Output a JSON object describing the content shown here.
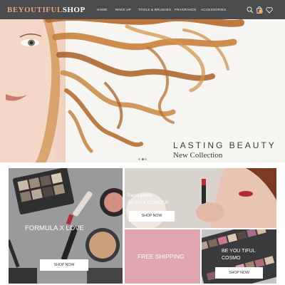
{
  "header": {
    "logo_part1": "BEYOUTIFUL",
    "logo_part2": "SHOP",
    "nav": [
      "HOME",
      "MAKE UP",
      "TOOLS & BRUSHES",
      "FRAGRANCE",
      "ACCESSORIES"
    ],
    "icons": [
      "search-icon",
      "bag-icon",
      "heart-icon"
    ],
    "cart_count": "0"
  },
  "hero": {
    "title": "LASTING BEAUTY",
    "subtitle": "New Collection",
    "slide_count": 3,
    "active_slide": 2
  },
  "tiles": {
    "formula": {
      "label": "FORMULA X LOVE",
      "button": "SHOP NOW"
    },
    "lipstick": {
      "label1": "Red Lipstick",
      "label2": "BEAUTY CLINIQUE",
      "button": "SHOP NOW"
    },
    "shipping": {
      "label": "FREE SHIPPING"
    },
    "cosmo": {
      "label1": "BE YOU TIFUL",
      "label2": "COSMO",
      "button": "SHOP NOW"
    }
  },
  "colors": {
    "header_bg": "#4a4b4d",
    "logo_accent": "#e9a07e",
    "shipping_bg": "#e1a6b0",
    "badge": "#f0a23a"
  }
}
